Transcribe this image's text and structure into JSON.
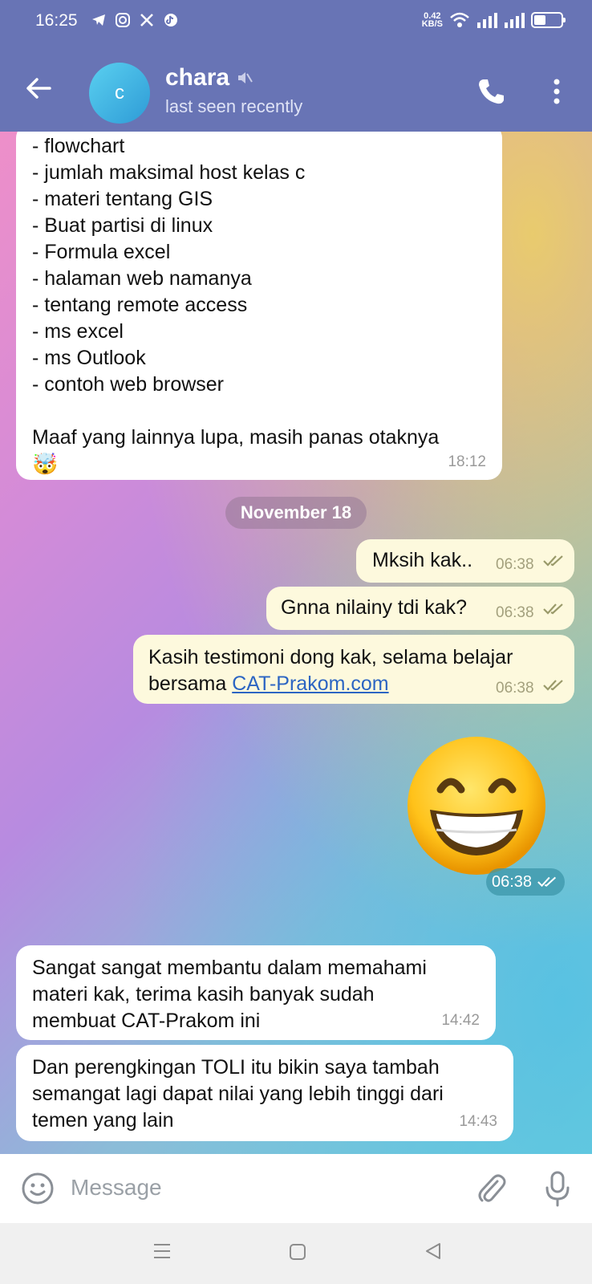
{
  "status": {
    "time": "16:25",
    "speed_value": "0.42",
    "speed_unit": "KB/S",
    "app_icons": [
      "telegram-icon",
      "instagram-icon",
      "x-icon",
      "tiktok-icon"
    ]
  },
  "header": {
    "avatar_letter": "c",
    "name": "chara",
    "subtitle": "last seen recently"
  },
  "messages": {
    "m1": {
      "lines": [
        "- flowchart",
        "- jumlah maksimal host kelas c",
        "- materi tentang GIS",
        "- Buat partisi di linux",
        "- Formula excel",
        "- halaman web namanya",
        "- tentang remote access",
        "- ms excel",
        "- ms Outlook",
        "- contoh web browser",
        "",
        "Maaf yang lainnya lupa, masih panas otaknya"
      ],
      "emoji": "🤯",
      "time": "18:12"
    },
    "date_separator": "November 18",
    "m2": {
      "text": "Mksih kak..",
      "time": "06:38"
    },
    "m3": {
      "text": "Gnna nilainy tdi kak?",
      "time": "06:38"
    },
    "m4": {
      "text_before": "Kasih testimoni dong kak, selama belajar bersama ",
      "link": "CAT-Prakom.com",
      "time": "06:38"
    },
    "m5": {
      "emoji": "😁",
      "time": "06:38"
    },
    "m6": {
      "lines": [
        "Sangat sangat membantu dalam memahami",
        "materi kak, terima kasih banyak sudah",
        "membuat CAT-Prakom ini"
      ],
      "time": "14:42"
    },
    "m7": {
      "lines": [
        "Dan perengkingan TOLI itu bikin saya tambah",
        "semangat lagi dapat nilai yang lebih tinggi dari",
        "temen yang lain"
      ],
      "time": "14:43"
    }
  },
  "input": {
    "placeholder": "Message"
  },
  "colors": {
    "header": "#6874b5",
    "outgoing": "#fdf9dd",
    "incoming": "#ffffff",
    "link": "#2c65c3"
  }
}
